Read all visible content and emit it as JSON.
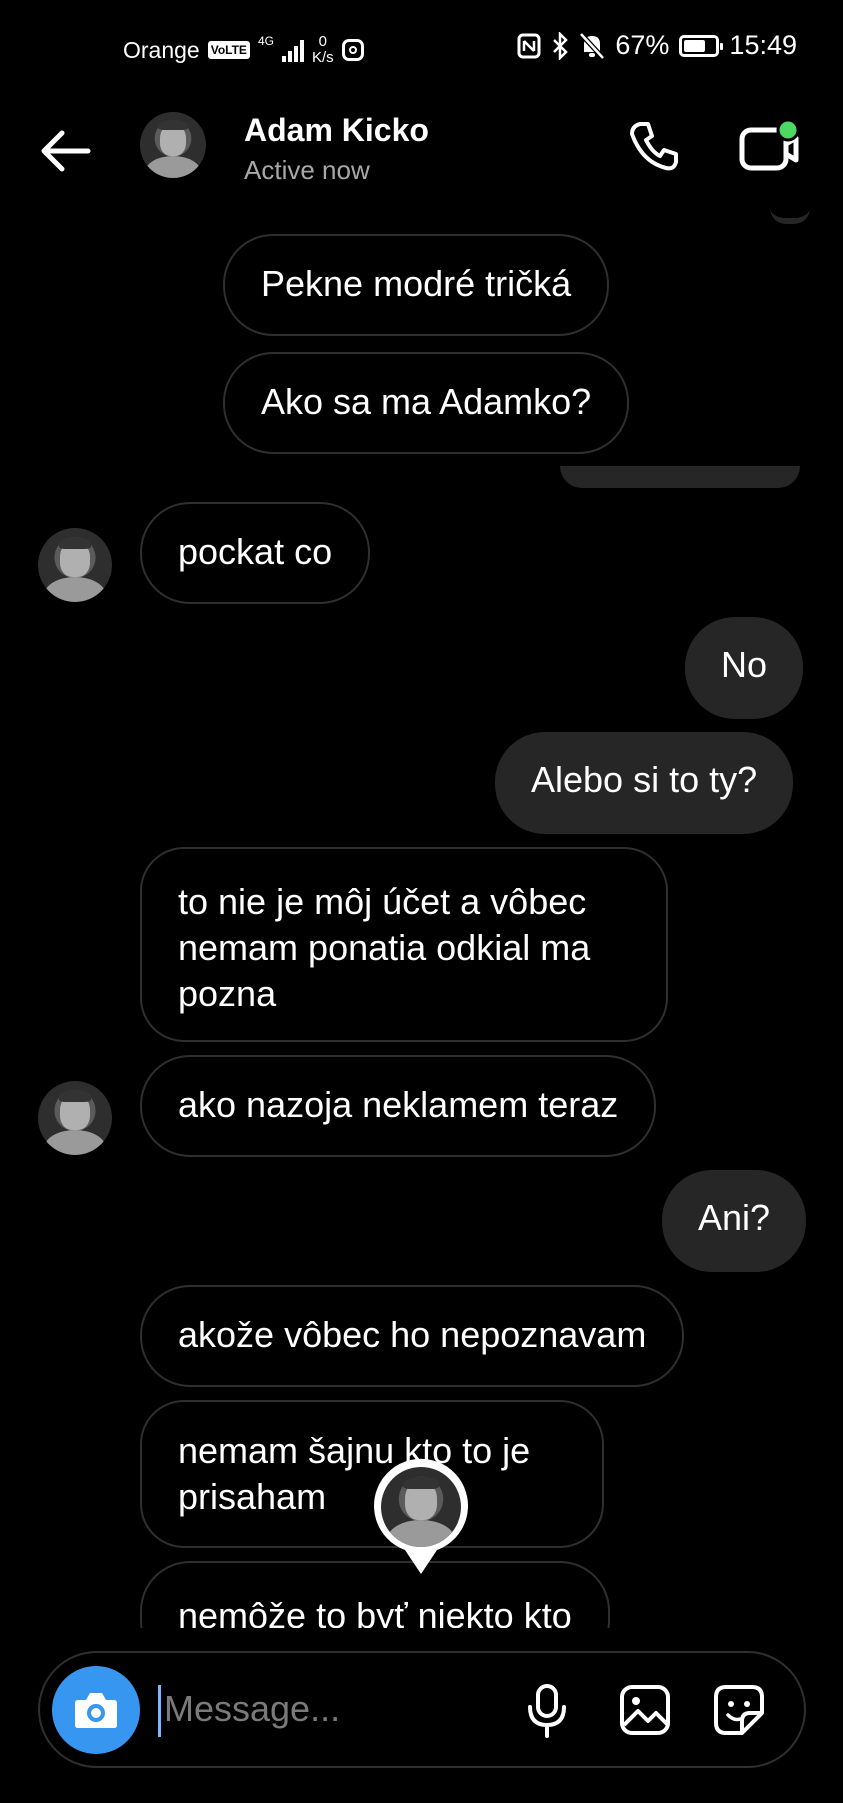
{
  "status_bar": {
    "carrier": "Orange",
    "volte": "VoLTE",
    "network": "4G",
    "speed_value": "0",
    "speed_unit": "K/s",
    "battery": "67%",
    "battery_level": 0.67,
    "time": "15:49"
  },
  "header": {
    "name": "Adam Kicko",
    "status": "Active now",
    "online_color": "#4cd964"
  },
  "messages": [
    {
      "from": "me-shared",
      "text": "Pekne modré tričká"
    },
    {
      "from": "me-shared",
      "text": "Ako sa ma Adamko?"
    },
    {
      "from": "them",
      "text": "pockat co"
    },
    {
      "from": "me",
      "text": "No"
    },
    {
      "from": "me",
      "text": "Alebo si to ty?"
    },
    {
      "from": "them",
      "text": "to nie je môj účet a vôbec nemam ponatia odkial ma pozna"
    },
    {
      "from": "them",
      "text": "ako nazoja neklamem teraz"
    },
    {
      "from": "me",
      "text": "Ani?"
    },
    {
      "from": "them",
      "text": "akože vôbec ho nepoznavam"
    },
    {
      "from": "them",
      "text": "nemam šajnu kto to je prisaham"
    },
    {
      "from": "them",
      "text": "nemôže to byť niekto kto"
    }
  ],
  "composer": {
    "placeholder": "Message...",
    "camera_color": "#3797f0"
  },
  "icons": [
    "back-arrow-icon",
    "phone-icon",
    "video-call-icon",
    "camera-icon",
    "microphone-icon",
    "gallery-icon",
    "sticker-icon"
  ]
}
